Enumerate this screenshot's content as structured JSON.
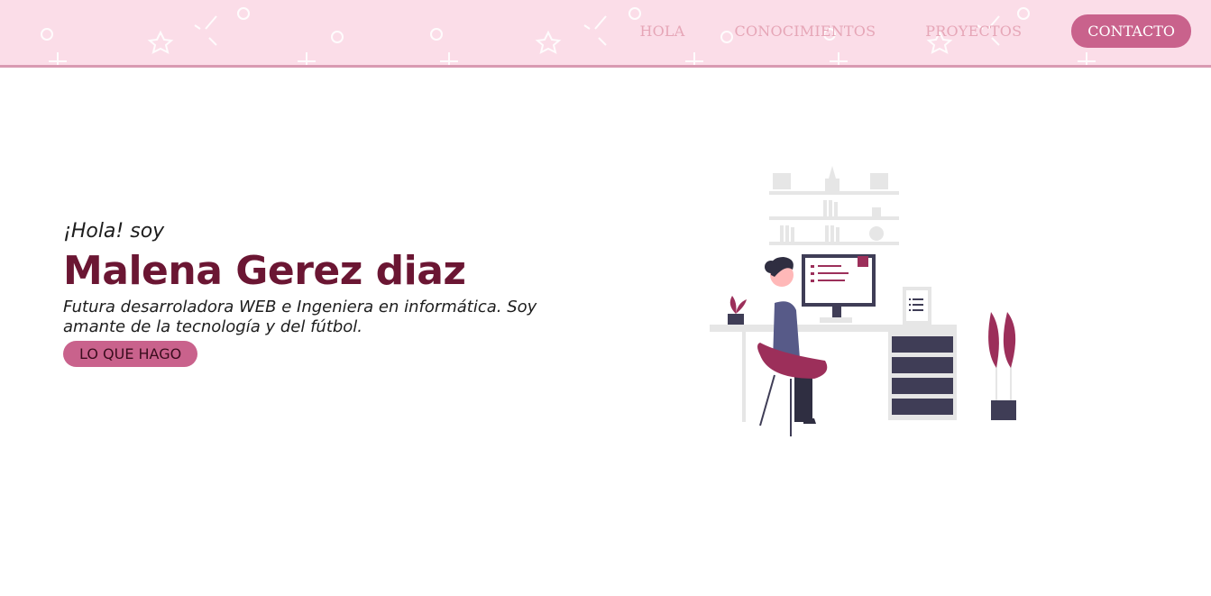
{
  "nav": {
    "links": [
      "HOLA",
      "CONOCIMIENTOS",
      "PROYECTOS"
    ],
    "cta": "CONTACTO"
  },
  "hero": {
    "greeting": "¡Hola! soy",
    "name": "Malena Gerez diaz",
    "tagline": "Futura desarroladora WEB e Ingeniera en informática. Soy amante de la tecnología y del fútbol.",
    "button": "LO QUE HAGO"
  },
  "colors": {
    "nav_background": "#fbdde8",
    "accent": "#c9628c",
    "name_color": "#6b1633",
    "link_color": "#e6a6b7"
  },
  "icons": [
    "star-icon",
    "circle-icon",
    "plus-icon",
    "sparkle-icon"
  ]
}
